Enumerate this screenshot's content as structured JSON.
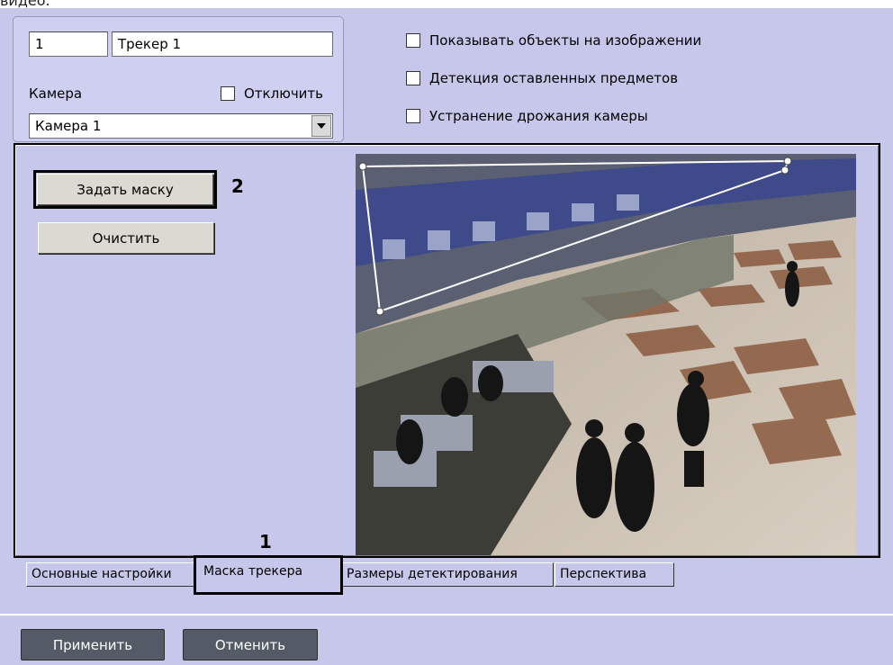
{
  "caption": "видео.",
  "object": {
    "id": "1",
    "name": "Трекер 1",
    "camera_label": "Камера",
    "disable_label": "Отключить",
    "camera_value": "Камера 1"
  },
  "options": [
    "Показывать объекты на изображении",
    "Детекция оставленных предметов",
    "Устранение дрожания камеры"
  ],
  "mask": {
    "set_mask_label": "Задать маску",
    "clear_label": "Очистить",
    "marker_set": "2",
    "marker_tab": "1"
  },
  "tabs": [
    "Основные настройки",
    "Маска трекера",
    "Размеры детектирования",
    "Перспектива"
  ],
  "footer": {
    "apply_label": "Применить",
    "cancel_label": "Отменить"
  }
}
